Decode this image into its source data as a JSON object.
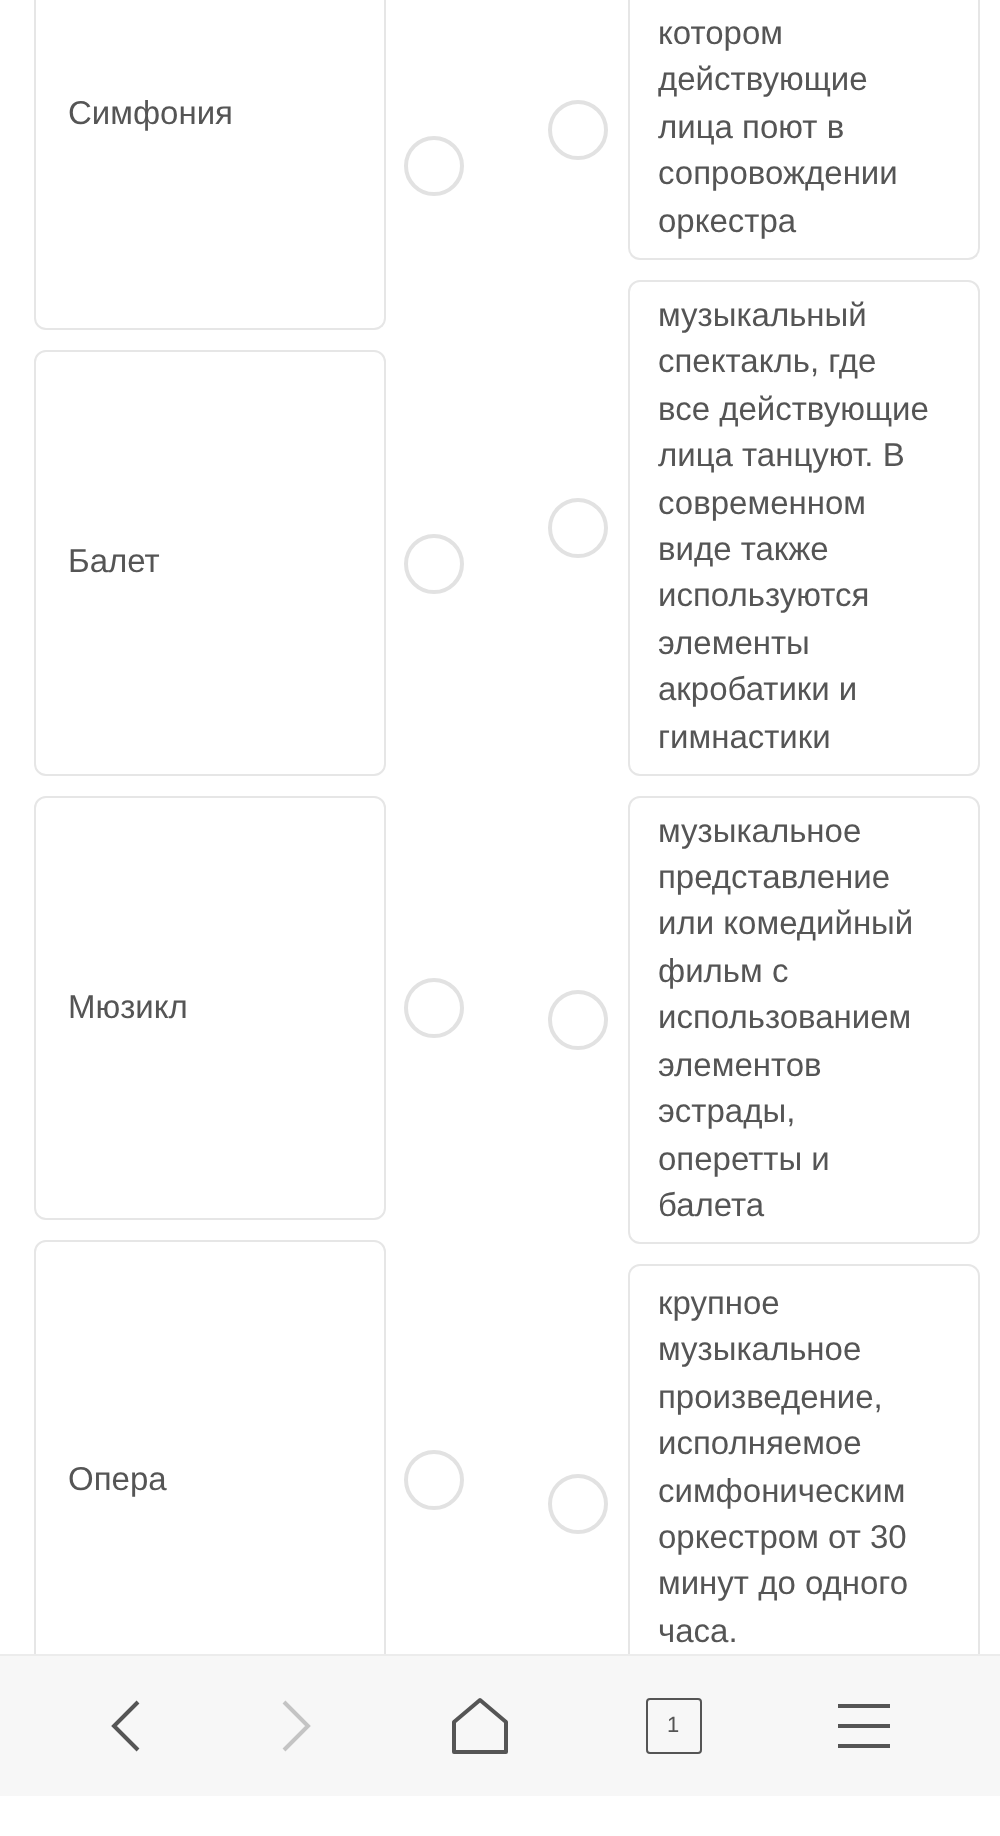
{
  "terms": [
    {
      "label": "Симфония",
      "selected": false
    },
    {
      "label": "Балет",
      "selected": false
    },
    {
      "label": "Мюзикл",
      "selected": false
    },
    {
      "label": "Опера",
      "selected": false
    }
  ],
  "definitions": [
    {
      "text": "котором\nдействующие\nлица поют в\nсопровождении\nоркестра",
      "selected": false
    },
    {
      "text": "музыкальный\nспектакль, где\nвсе действующие\nлица танцуют. В\nсовременном\nвиде также\nиспользуются\nэлементы\nакробатики и\nгимнастики",
      "selected": false
    },
    {
      "text": "музыкальное\nпредставление\nили комедийный\nфильм с\nиспользованием\nэлементов\nэстрады,\nоперетты и\nбалета",
      "selected": false
    },
    {
      "text": "крупное\nмузыкальное\nпроизведение,\nисполняемое\nсимфоническим\nоркестром от 30\nминут до одного\nчаса.",
      "selected": false
    }
  ],
  "nav_bar": [
    {
      "kind": "back",
      "disabled": false
    },
    {
      "kind": "forward",
      "disabled": true
    },
    {
      "kind": "home",
      "disabled": false
    },
    {
      "kind": "tabs",
      "label": "1",
      "disabled": false
    },
    {
      "kind": "menu",
      "disabled": false
    }
  ]
}
